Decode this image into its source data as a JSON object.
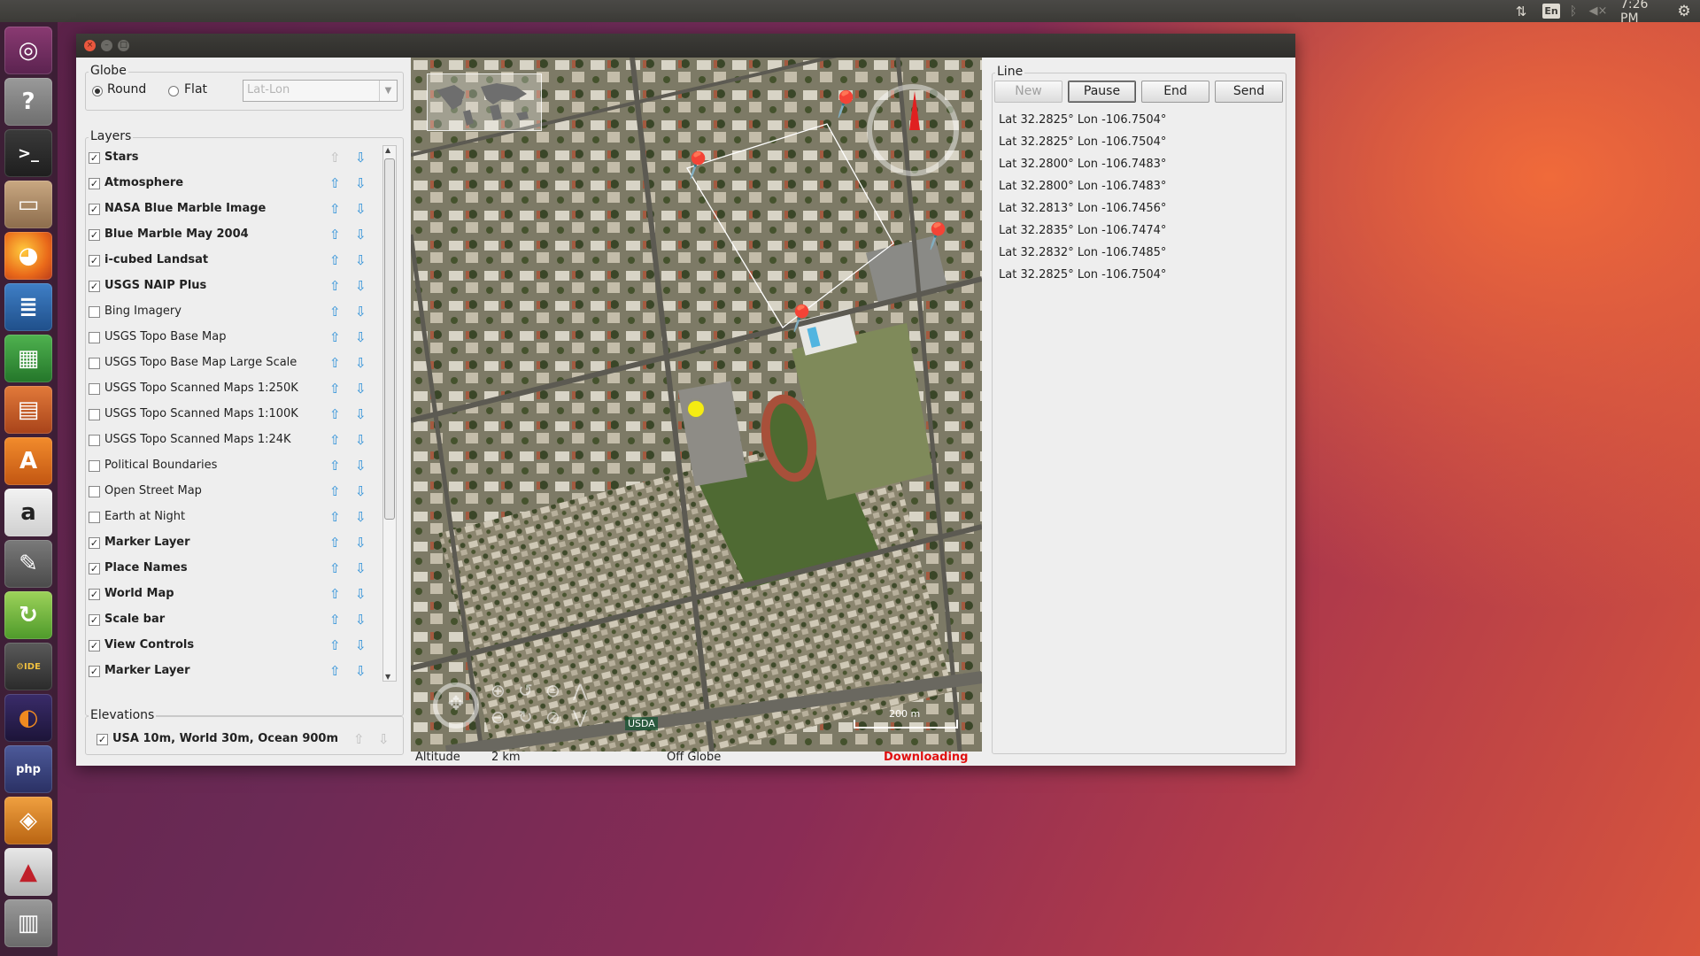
{
  "topbar": {
    "lang": "En",
    "clock": "7:26 PM"
  },
  "launcher": {
    "items": [
      "ubuntu-dash",
      "help",
      "terminal",
      "files",
      "firefox",
      "writer",
      "calc",
      "impress",
      "software-center",
      "amazon",
      "settings",
      "update-manager",
      "java-ee-ide",
      "eclipse",
      "php-ide",
      "app-installer",
      "java-app",
      "trash"
    ]
  },
  "globe": {
    "title": "Globe",
    "round_label": "Round",
    "flat_label": "Flat",
    "projection_mode": "Round",
    "projection_placeholder": "Lat-Lon"
  },
  "layers": {
    "title": "Layers",
    "items": [
      {
        "label": "Stars",
        "checked": true
      },
      {
        "label": "Atmosphere",
        "checked": true
      },
      {
        "label": "NASA Blue Marble Image",
        "checked": true
      },
      {
        "label": "Blue Marble May 2004",
        "checked": true
      },
      {
        "label": "i-cubed Landsat",
        "checked": true
      },
      {
        "label": "USGS NAIP Plus",
        "checked": true
      },
      {
        "label": "Bing Imagery",
        "checked": false
      },
      {
        "label": "USGS Topo Base Map",
        "checked": false
      },
      {
        "label": "USGS Topo Base Map Large Scale",
        "checked": false
      },
      {
        "label": "USGS Topo Scanned Maps 1:250K",
        "checked": false
      },
      {
        "label": "USGS Topo Scanned Maps 1:100K",
        "checked": false
      },
      {
        "label": "USGS Topo Scanned Maps 1:24K",
        "checked": false
      },
      {
        "label": "Political Boundaries",
        "checked": false
      },
      {
        "label": "Open Street Map",
        "checked": false
      },
      {
        "label": "Earth at Night",
        "checked": false
      },
      {
        "label": "Marker Layer",
        "checked": true
      },
      {
        "label": "Place Names",
        "checked": true
      },
      {
        "label": "World Map",
        "checked": true
      },
      {
        "label": "Scale bar",
        "checked": true
      },
      {
        "label": "View Controls",
        "checked": true
      },
      {
        "label": "Marker Layer",
        "checked": true
      }
    ]
  },
  "elevations": {
    "title": "Elevations",
    "item": {
      "label": "USA 10m, World 30m, Ocean 900m",
      "checked": true
    }
  },
  "map": {
    "scale_label": "200 m",
    "watermark": "USDA"
  },
  "status": {
    "altitude_label": "Altitude",
    "altitude_value": "2 km",
    "position": "Off Globe",
    "downloading": "Downloading",
    "downloading_color": "#e01010"
  },
  "line": {
    "title": "Line",
    "buttons": {
      "new": "New",
      "pause": "Pause",
      "end": "End",
      "send": "Send"
    },
    "coordinates": [
      "Lat 32.2825° Lon -106.7504°",
      "Lat 32.2825° Lon -106.7504°",
      "Lat 32.2800° Lon -106.7483°",
      "Lat 32.2800° Lon -106.7483°",
      "Lat 32.2813° Lon -106.7456°",
      "Lat 32.2835° Lon -106.7474°",
      "Lat 32.2832° Lon -106.7485°",
      "Lat 32.2825° Lon -106.7504°"
    ]
  }
}
